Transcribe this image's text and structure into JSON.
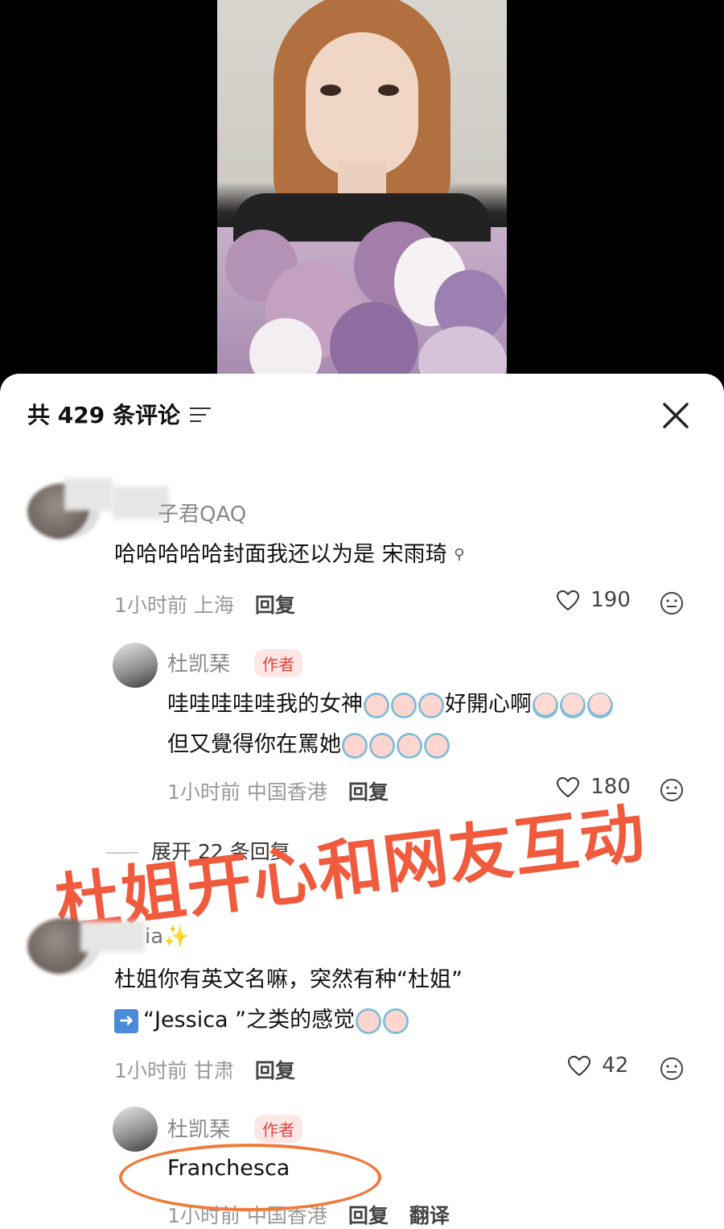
{
  "header": {
    "title": "共 429 条评论"
  },
  "overlay": {
    "caption": "杜姐开心和网友互动"
  },
  "comments": [
    {
      "username": "子君QAQ",
      "text": "哈哈哈哈哈封面我还以为是 宋雨琦",
      "time": "1小时前",
      "location": "上海",
      "reply_label": "回复",
      "likes": "190",
      "reply": {
        "username": "杜凯琹",
        "badge": "作者",
        "line1": "哇哇哇哇哇我的女神",
        "line1b": "好開心啊",
        "line2": "但又覺得你在罵她",
        "time": "1小时前",
        "location": "中国香港",
        "reply_label": "回复",
        "likes": "180"
      },
      "expand_label": "展开 22 条回复"
    },
    {
      "username": "ia✨",
      "text1": "杜姐你有英文名嘛，突然有种“杜姐”",
      "text2": "“Jessica ”之类的感觉",
      "time": "1小时前",
      "location": "甘肃",
      "reply_label": "回复",
      "likes": "42",
      "reply": {
        "username": "杜凯琹",
        "badge": "作者",
        "text": "Franchesca",
        "time": "1小时前",
        "location": "中国香港",
        "reply_label": "回复",
        "translate_label": "翻译"
      }
    }
  ],
  "colors": {
    "overlay": "#f05b3e",
    "badge": "#e0443f",
    "ellipse": "#f07a3c"
  },
  "icons": [
    "filter-icon",
    "close-icon",
    "heart-icon",
    "emoji-icon",
    "search-icon-small",
    "arrow-right-icon"
  ]
}
